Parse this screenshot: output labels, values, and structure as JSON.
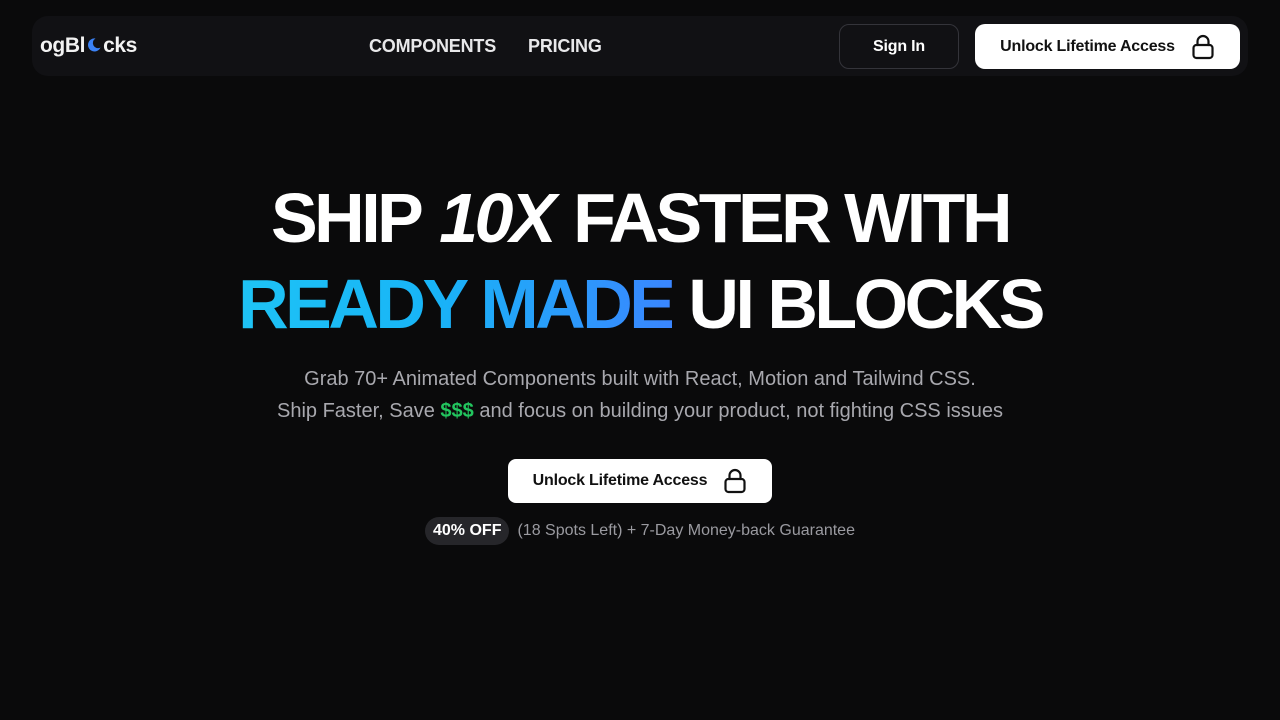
{
  "brand": {
    "logo_prefix": "ogBl",
    "logo_suffix": "cks",
    "logo_icon": "crescent-moon-icon",
    "accent_color": "#3b82f6"
  },
  "nav": {
    "links": [
      {
        "label": "COMPONENTS"
      },
      {
        "label": "PRICING"
      }
    ],
    "signin_label": "Sign In",
    "unlock_label": "Unlock Lifetime Access",
    "unlock_icon": "lock-icon"
  },
  "hero": {
    "line1_part1": "SHIP",
    "line1_italic": "10X",
    "line1_part2": "FASTER WITH",
    "line2_gradient": "READY MADE",
    "line2_rest": "UI BLOCKS",
    "gradient_colors": [
      "#1ec3f5",
      "#3a86ff"
    ],
    "sub_line1": "Grab 70+ Animated Components built with React, Motion and Tailwind CSS.",
    "sub_line2_before": "Ship Faster, Save",
    "sub_line2_money": "$$$",
    "sub_line2_after": "and focus on building your product, not fighting CSS issues",
    "money_color": "#22c55e",
    "cta_label": "Unlock Lifetime Access",
    "cta_icon": "lock-icon"
  },
  "promo": {
    "badge": "40% OFF",
    "text": "(18 Spots Left) + 7-Day Money-back Guarantee"
  }
}
